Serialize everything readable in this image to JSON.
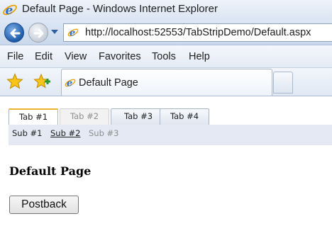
{
  "window": {
    "title": "Default Page - Windows Internet Explorer",
    "app_icon": "ie-icon"
  },
  "navigation": {
    "back_icon": "back-arrow-icon",
    "forward_icon": "forward-arrow-icon",
    "url": "http://localhost:52553/TabStripDemo/Default.aspx"
  },
  "menu": [
    "File",
    "Edit",
    "View",
    "Favorites",
    "Tools",
    "Help"
  ],
  "favorites_bar": {
    "favorites_icon": "star-icon",
    "add_favorites_icon": "add-favorites-icon"
  },
  "browser_tab": {
    "title": "Default Page"
  },
  "page": {
    "tabs": [
      {
        "label": "Tab #1",
        "state": "selected"
      },
      {
        "label": "Tab #2",
        "state": "disabled"
      },
      {
        "label": "Tab #3",
        "state": "normal"
      },
      {
        "label": "Tab #4",
        "state": "normal"
      }
    ],
    "subtabs": [
      {
        "label": "Sub #1",
        "state": "normal"
      },
      {
        "label": "Sub #2",
        "state": "selected"
      },
      {
        "label": "Sub #3",
        "state": "disabled"
      }
    ],
    "heading": "Default Page",
    "postback_label": "Postback"
  },
  "colors": {
    "chrome_blue": "#dbe5f2",
    "active_tab_accent": "#f0b030",
    "subtab_bar": "#e4e9f4",
    "disabled_text": "#8e8e8e"
  }
}
